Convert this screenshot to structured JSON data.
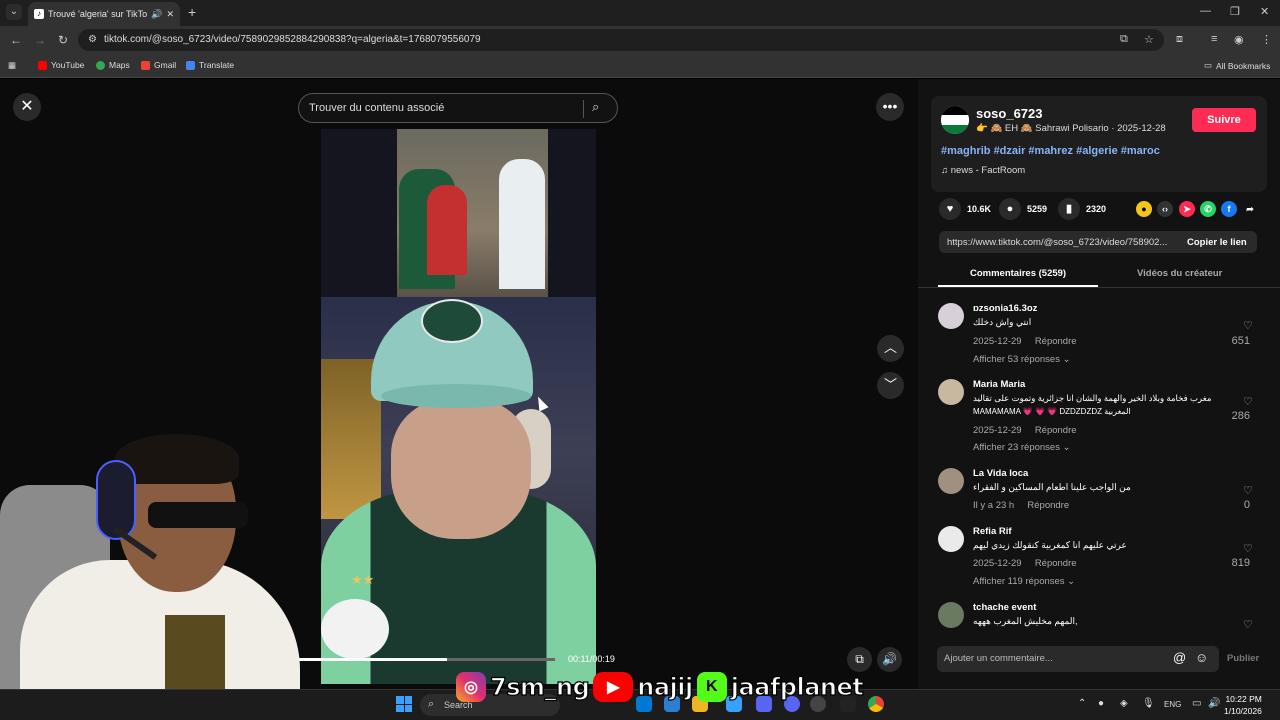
{
  "browser": {
    "tab_title": "Trouvé 'algeria' sur TikTok |",
    "url": "tiktok.com/@soso_6723/video/7589029852884290838?q=algeria&t=1768079556079",
    "bookmarks": [
      "YouTube",
      "Maps",
      "Gmail",
      "Translate"
    ],
    "all_bookmarks": "All Bookmarks"
  },
  "player": {
    "search_placeholder": "Trouver du contenu associé",
    "time": "00:11/00:19",
    "progress": 0.58
  },
  "overlay": {
    "instagram": "7sm_ng",
    "youtube": "najij",
    "kick": "jaafplanet"
  },
  "post": {
    "username": "soso_6723",
    "subline": "👉 🙈 EH 🙈 Sahrawi Polisario · 2025-12-28",
    "follow": "Suivre",
    "hashtags": "#maghrib #dzair #mahrez #algerie #maroc",
    "music": "news - FactRoom",
    "likes": "10.6K",
    "comments": "5259",
    "saves": "2320",
    "link": "https://www.tiktok.com/@soso_6723/video/758902...",
    "copy_link": "Copier le lien",
    "tab_comments": "Commentaires (5259)",
    "tab_videos": "Vidéos du créateur"
  },
  "comments": [
    {
      "name": "ɒzsonia16.3oz",
      "text": "انتي واش دخلك",
      "date": "2025-12-29",
      "reply": "Répondre",
      "more": "Afficher 53 réponses",
      "likes": "651"
    },
    {
      "name": "Maria Maria",
      "text": "مغرب فخامة وبلاد الخير والهمة والشان انا جزائرية وتموت على تقاليد",
      "text2": "MAMAMAMA 💗 💗 💗 DZDZDZDZ المغربية",
      "date": "2025-12-29",
      "reply": "Répondre",
      "more": "Afficher 23 réponses",
      "likes": "286"
    },
    {
      "name": "La Vida loca",
      "text": "من الواجب علينا اطعام المساكين و الفقراء",
      "date": "Il y a 23 h",
      "reply": "Répondre",
      "more": "",
      "likes": "0"
    },
    {
      "name": "Refia Rif",
      "text": "عرتي عليهم انا كمغربية كنقولك زيدي ليهم",
      "date": "2025-12-29",
      "reply": "Répondre",
      "more": "Afficher 119 réponses",
      "likes": "819"
    },
    {
      "name": "tchache event",
      "text": "المهم مخليش المغرب هههه,",
      "date": "",
      "reply": "",
      "more": "",
      "likes": ""
    }
  ],
  "comment_input": {
    "placeholder": "Ajouter un commentaire...",
    "publish": "Publier"
  },
  "taskbar": {
    "search": "Search",
    "lang": "ENG",
    "time": "10:22 PM",
    "date": "1/10/2026"
  }
}
